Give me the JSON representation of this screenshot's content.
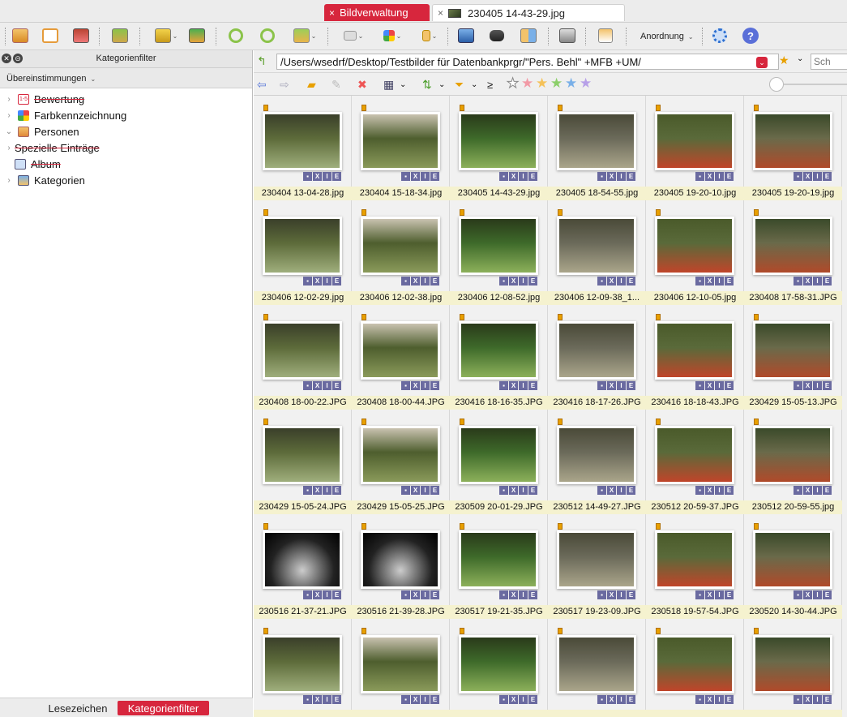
{
  "tabs": [
    {
      "label": "Bildverwaltung",
      "close": "×"
    },
    {
      "label": "230405 14-43-29.jpg",
      "close": "×"
    }
  ],
  "toolbar": {
    "arrange_label": "Anordnung"
  },
  "left_panel": {
    "title": "Kategorienfilter",
    "subheader": "Übereinstimmungen",
    "tree": [
      {
        "label": "Bewertung",
        "struck": true,
        "icon": "rating-icon"
      },
      {
        "label": "Farbkennzeichnung",
        "struck": false,
        "icon": "color-label-icon"
      },
      {
        "label": "Personen",
        "struck": false,
        "icon": "person-icon"
      },
      {
        "label": "Spezielle Einträge",
        "struck": true,
        "icon": "none"
      },
      {
        "label": "Album",
        "struck": true,
        "icon": "album-icon"
      },
      {
        "label": "Kategorien",
        "struck": false,
        "icon": "categories-icon"
      }
    ],
    "footer_tabs": [
      "Lesezeichen",
      "Kategorienfilter"
    ]
  },
  "path": {
    "value": "/Users/wsedrf/Desktop/Testbilder für Datenbankprgr/\"Pers. Behl\" +MFB +UM/",
    "search_placeholder": "Sch"
  },
  "colors": {
    "accent": "#d7263d",
    "label_bg": "#f5f2cf",
    "badge": "#6a6aa0"
  },
  "files": [
    "230404 13-04-28.jpg",
    "230404 15-18-34.jpg",
    "230405 14-43-29.jpg",
    "230405 18-54-55.jpg",
    "230405 19-20-10.jpg",
    "230405 19-20-19.jpg",
    "230406 12-02-29.jpg",
    "230406 12-02-38.jpg",
    "230406 12-08-52.jpg",
    "230406 12-09-38_1...",
    "230406 12-10-05.jpg",
    "230408 17-58-31.JPG",
    "230408 18-00-22.JPG",
    "230408 18-00-44.JPG",
    "230416 18-16-35.JPG",
    "230416 18-17-26.JPG",
    "230416 18-18-43.JPG",
    "230429 15-05-13.JPG",
    "230429 15-05-24.JPG",
    "230429 15-05-25.JPG",
    "230509 20-01-29.JPG",
    "230512 14-49-27.JPG",
    "230512 20-59-37.JPG",
    "230512 20-59-55.jpg",
    "230516 21-37-21.JPG",
    "230516 21-39-28.JPG",
    "230517 19-21-35.JPG",
    "230517 19-23-09.JPG",
    "230518 19-57-54.JPG",
    "230520 14-30-44.JPG",
    "",
    "",
    "",
    "",
    "",
    ""
  ],
  "badges": [
    "X",
    "I",
    "E"
  ]
}
